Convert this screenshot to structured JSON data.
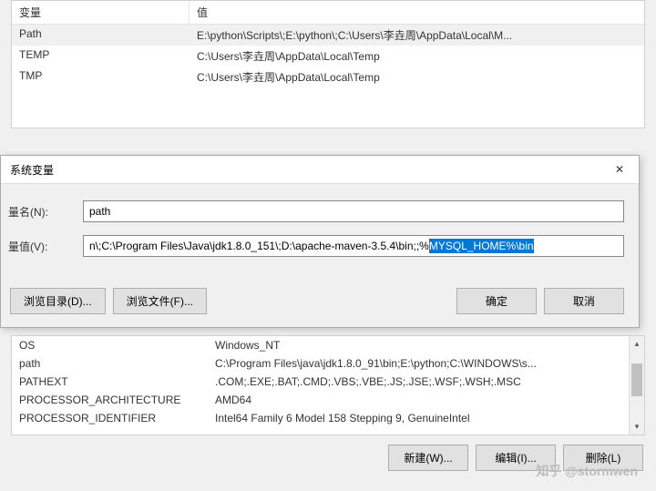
{
  "upper": {
    "headers": {
      "var": "变量",
      "val": "值"
    },
    "rows": [
      {
        "var": "Path",
        "val": "E:\\python\\Scripts\\;E:\\python\\;C:\\Users\\李垚周\\AppData\\Local\\M..."
      },
      {
        "var": "TEMP",
        "val": "C:\\Users\\李垚周\\AppData\\Local\\Temp"
      },
      {
        "var": "TMP",
        "val": "C:\\Users\\李垚周\\AppData\\Local\\Temp"
      }
    ]
  },
  "dialog": {
    "title": "系统变量",
    "name_label": "量名(N):",
    "value_label": "量值(V):",
    "name_value": "path",
    "value_prefix": "n\\;C:\\Program Files\\Java\\jdk1.8.0_151\\;D:\\apache-maven-3.5.4\\bin;;%",
    "value_selected": "MYSQL_HOME%\\bin",
    "browse_dir": "浏览目录(D)...",
    "browse_file": "浏览文件(F)...",
    "ok": "确定",
    "cancel": "取消"
  },
  "lower": {
    "rows": [
      {
        "var": "OS",
        "val": "Windows_NT"
      },
      {
        "var": "path",
        "val": "C:\\Program Files\\java\\jdk1.8.0_91\\bin;E:\\python;C:\\WINDOWS\\s..."
      },
      {
        "var": "PATHEXT",
        "val": ".COM;.EXE;.BAT;.CMD;.VBS;.VBE;.JS;.JSE;.WSF;.WSH;.MSC"
      },
      {
        "var": "PROCESSOR_ARCHITECTURE",
        "val": "AMD64"
      },
      {
        "var": "PROCESSOR_IDENTIFIER",
        "val": "Intel64 Family 6 Model 158 Stepping 9, GenuineIntel"
      }
    ],
    "new_btn": "新建(W)...",
    "edit_btn": "编辑(I)...",
    "delete_btn": "删除(L)"
  },
  "watermark": "知乎 @stormwen"
}
